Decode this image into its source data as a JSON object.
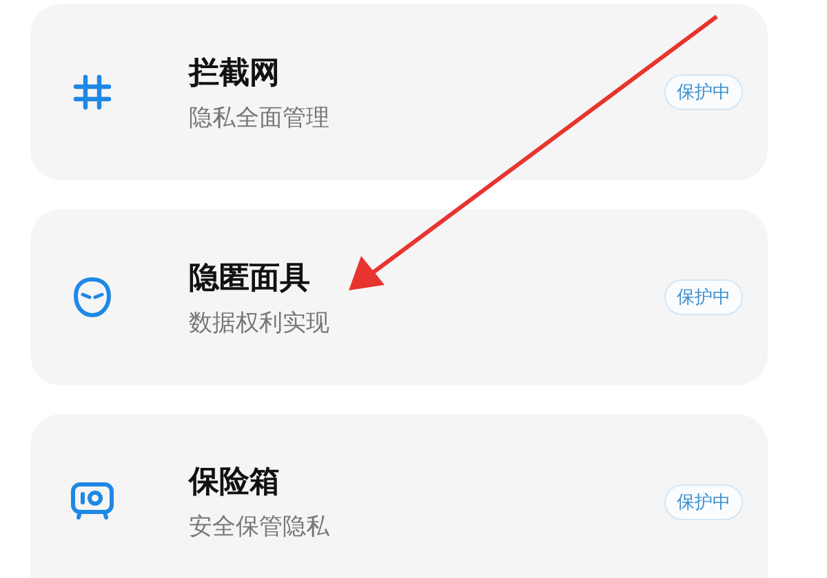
{
  "items": [
    {
      "kind": "hash",
      "title": "拦截网",
      "subtitle": "隐私全面管理",
      "badge": "保护中"
    },
    {
      "kind": "mask",
      "title": "隐匿面具",
      "subtitle": "数据权利实现",
      "badge": "保护中"
    },
    {
      "kind": "safe",
      "title": "保险箱",
      "subtitle": "安全保管隐私",
      "badge": "保护中"
    }
  ]
}
